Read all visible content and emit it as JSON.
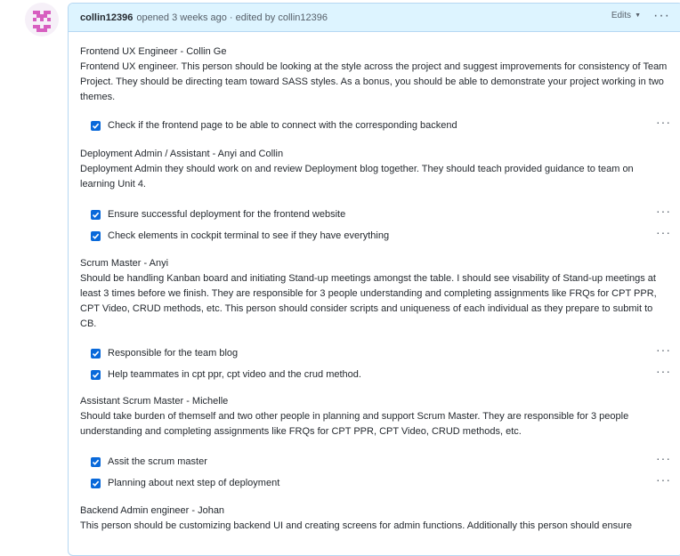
{
  "colors": {
    "accent": "#0969da",
    "header_bg": "#ddf4ff",
    "border": "#b6d7f2"
  },
  "header": {
    "author": "collin12396",
    "meta": "opened 3 weeks ago · edited by collin12396",
    "edits_label": "Edits",
    "more_icon": "kebab-horizontal-icon"
  },
  "sections": [
    {
      "title": "Frontend UX Engineer - Collin Ge",
      "description": "Frontend UX engineer. This person should be looking at the style across the project and suggest improvements for consistency of Team Project. They should be directing team toward SASS styles. As a bonus, you should be able to demonstrate your project working in two themes.",
      "tasks": [
        {
          "label": "Check if the frontend page to be able to connect with the corresponding backend",
          "checked": true
        }
      ]
    },
    {
      "title": "Deployment Admin / Assistant - Anyi and Collin",
      "description": "Deployment Admin they should work on and review Deployment blog together. They should teach provided guidance to team on learning Unit 4.",
      "tasks": [
        {
          "label": "Ensure successful deployment for the frontend website",
          "checked": true
        },
        {
          "label": "Check elements in cockpit terminal to see if they have everything",
          "checked": true
        }
      ]
    },
    {
      "title": "Scrum Master - Anyi",
      "description": "Should be handling Kanban board and initiating Stand-up meetings amongst the table. I should see visability of Stand-up meetings at least 3 times before we finish. They are responsible for 3 people understanding and completing assignments like FRQs for CPT PPR, CPT Video, CRUD methods, etc. This person should consider scripts and uniqueness of each individual as they prepare to submit to CB.",
      "tasks": [
        {
          "label": "Responsible for the team blog",
          "checked": true
        },
        {
          "label": "Help teammates in cpt ppr, cpt video and the crud method.",
          "checked": true
        }
      ]
    },
    {
      "title": "Assistant Scrum Master - Michelle",
      "description": "Should take burden of themself and two other people in planning and support Scrum Master. They are responsible for 3 people understanding and completing assignments like FRQs for CPT PPR, CPT Video, CRUD methods, etc.",
      "tasks": [
        {
          "label": "Assit the scrum master",
          "checked": true
        },
        {
          "label": "Planning about next step of deployment",
          "checked": true
        }
      ]
    },
    {
      "title": "Backend Admin engineer - Johan",
      "description": "This person should be customizing backend UI and creating screens for admin functions. Additionally this person should ensure",
      "tasks": []
    }
  ]
}
